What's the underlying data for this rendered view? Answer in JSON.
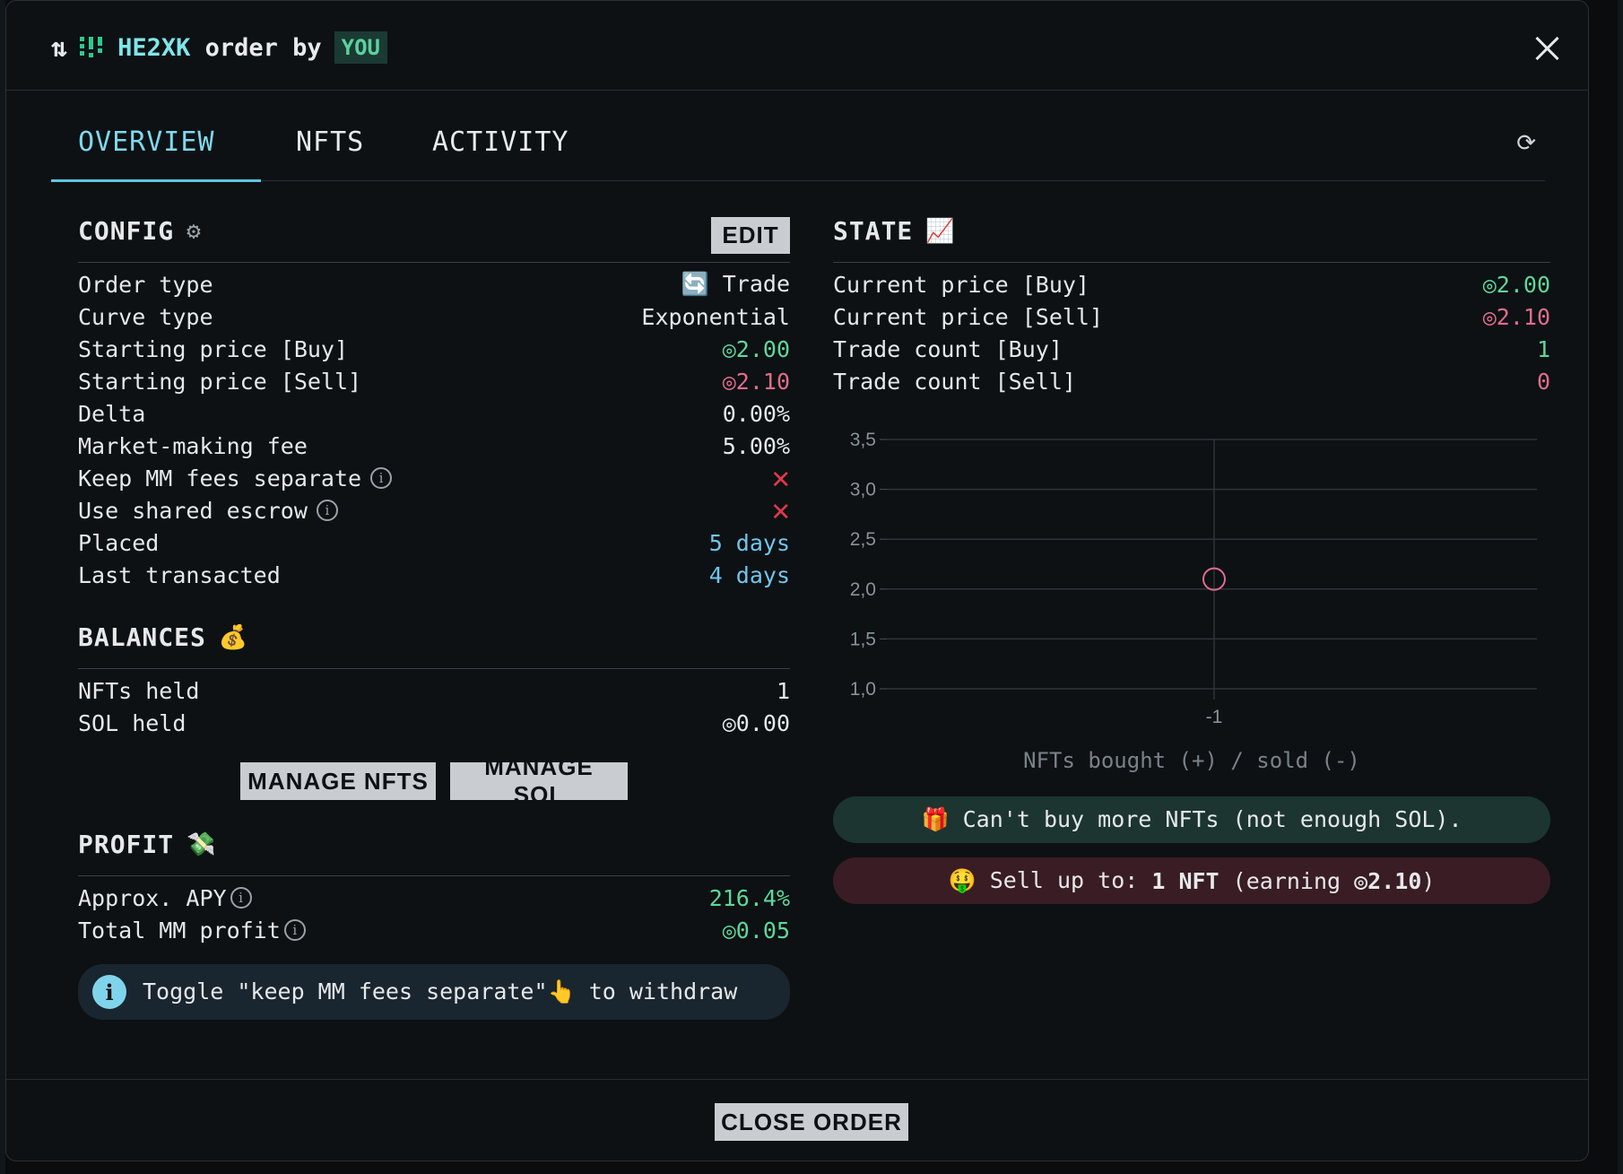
{
  "header": {
    "title_collection": "HE2XK",
    "title_rest": " order by",
    "owner_badge": "YOU"
  },
  "tabs": [
    {
      "label": "OVERVIEW",
      "active": true
    },
    {
      "label": "NFTS",
      "active": false
    },
    {
      "label": "ACTIVITY",
      "active": false
    }
  ],
  "config": {
    "title": "CONFIG",
    "edit_label": "EDIT",
    "rows": [
      {
        "label": "Order type",
        "value": "🔄 Trade"
      },
      {
        "label": "Curve type",
        "value": "Exponential"
      },
      {
        "label": "Starting price [Buy]",
        "value": "◎2.00"
      },
      {
        "label": "Starting price [Sell]",
        "value": "◎2.10"
      },
      {
        "label": "Delta",
        "value": "0.00%"
      },
      {
        "label": "Market-making fee",
        "value": "5.00%"
      },
      {
        "label": "Keep MM fees separate",
        "value": "✕"
      },
      {
        "label": "Use shared escrow",
        "value": "✕"
      },
      {
        "label": "Placed",
        "value": "5 days"
      },
      {
        "label": "Last transacted",
        "value": "4 days"
      }
    ]
  },
  "balances": {
    "title": "BALANCES",
    "rows": [
      {
        "label": "NFTs held",
        "value": "1"
      },
      {
        "label": "SOL held",
        "value": "◎0.00"
      }
    ],
    "manage_nfts_label": "MANAGE NFTS",
    "manage_sol_label": "MANAGE SOL"
  },
  "profit": {
    "title": "PROFIT",
    "rows": [
      {
        "label": "Approx. APY",
        "value": "216.4%"
      },
      {
        "label": "Total MM profit",
        "value": "◎0.05"
      }
    ],
    "note_text": "Toggle \"keep MM fees separate\"👆 to withdraw"
  },
  "state": {
    "title": "STATE",
    "rows": [
      {
        "label": "Current price [Buy]",
        "value": "◎2.00"
      },
      {
        "label": "Current price [Sell]",
        "value": "◎2.10"
      },
      {
        "label": "Trade count [Buy]",
        "value": "1"
      },
      {
        "label": "Trade count [Sell]",
        "value": "0"
      }
    ],
    "buy_status": "🎁 Can't buy more NFTs (not enough SOL).",
    "sell_status_prefix": "🤑 Sell up to: ",
    "sell_status_bold": "1 NFT",
    "sell_status_mid": " (earning ",
    "sell_status_bold2": "◎2.10",
    "sell_status_suffix": ")"
  },
  "chart_data": {
    "type": "scatter",
    "title": "",
    "xlabel": "NFTs bought (+) / sold (-)",
    "ylabel": "",
    "x_ticks": [
      "-1"
    ],
    "y_ticks": [
      "1,0",
      "1,5",
      "2,0",
      "2,5",
      "3,0",
      "3,5"
    ],
    "ylim": [
      1.0,
      3.5
    ],
    "grid": true,
    "series": [
      {
        "x": [
          -1
        ],
        "y": [
          2.1
        ],
        "color": "#e06d8a",
        "marker": "hollow-circle"
      }
    ]
  },
  "footer": {
    "close_order_label": "CLOSE ORDER"
  },
  "colors": {
    "accent": "#5ec7e0",
    "buy": "#5fd79a",
    "sell": "#e06d8a",
    "time": "#72c5ec"
  }
}
